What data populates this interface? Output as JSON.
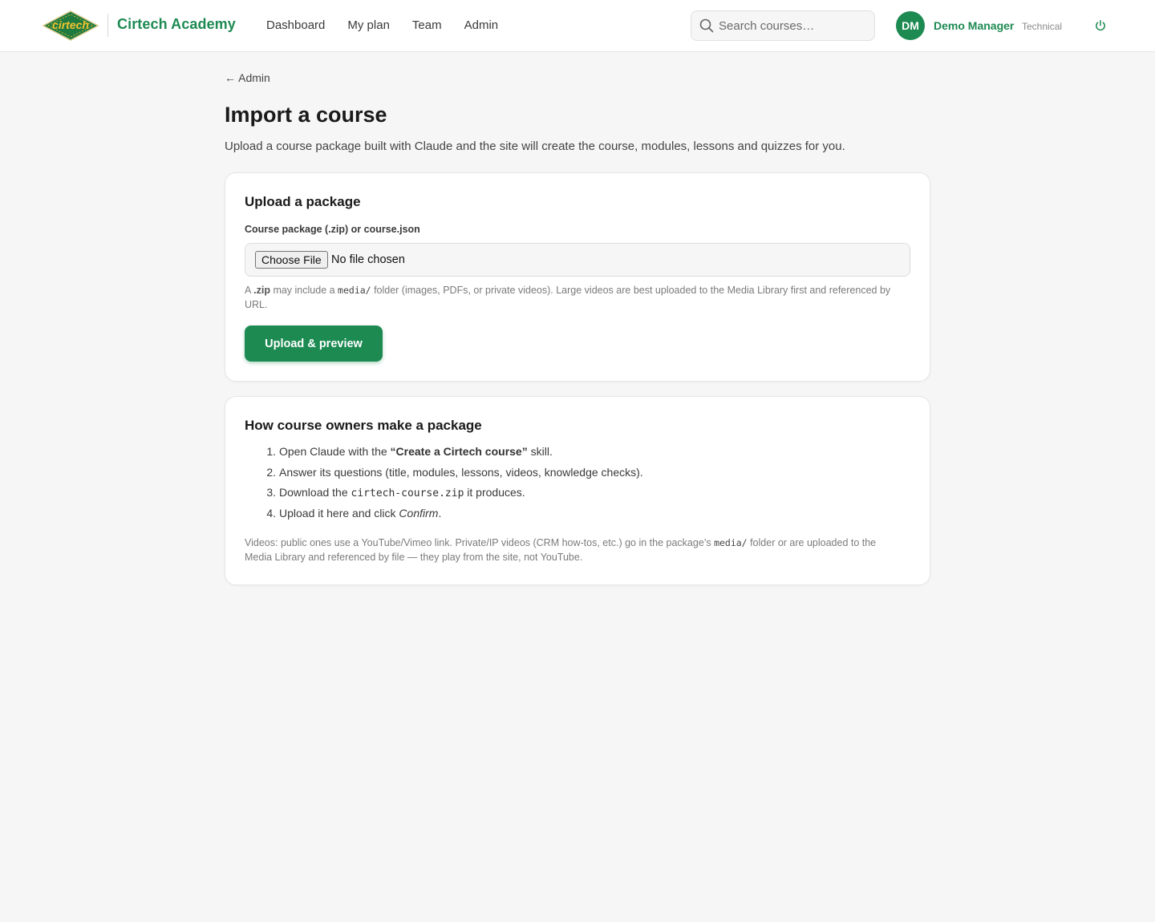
{
  "header": {
    "logo_text": "cirtech",
    "brand": "Cirtech Academy",
    "nav": [
      {
        "label": "Dashboard"
      },
      {
        "label": "My plan"
      },
      {
        "label": "Team"
      },
      {
        "label": "Admin"
      }
    ],
    "search_placeholder": "Search courses…",
    "user": {
      "initials": "DM",
      "name": "Demo Manager",
      "role": "Technical"
    },
    "colors": {
      "accent": "#1d8a52",
      "logo_fill": "#1f7a3f",
      "logo_text": "#f2c230"
    },
    "icons": {
      "search": "search-icon",
      "power": "power-icon"
    }
  },
  "page": {
    "back_label": "← Admin",
    "title": "Import a course",
    "subtitle": "Upload a course package built with Claude and the site will create the course, modules, lessons and quizzes for you."
  },
  "upload": {
    "heading": "Upload a package",
    "field_label": "Course package (.zip) or course.json",
    "file_button": "Choose File",
    "file_status": "No file chosen",
    "help": {
      "p1": "A ",
      "zip": ".zip",
      "p2": " may include a ",
      "media": "media/",
      "p3": " folder (images, PDFs, or private videos). Large videos are best uploaded to the Media Library first and referenced by URL."
    },
    "submit_label": "Upload & preview"
  },
  "how": {
    "heading": "How course owners make a package",
    "steps": [
      {
        "num": "1.",
        "a": "Open Claude with the ",
        "b": "“Create a Cirtech course”",
        "c": " skill."
      },
      {
        "num": "2.",
        "a": "Answer its questions (title, modules, lessons, videos, knowledge checks)."
      },
      {
        "num": "3.",
        "a": "Download the ",
        "code": "cirtech-course.zip",
        "c": " it produces."
      },
      {
        "num": "4.",
        "a": "Upload it here and click ",
        "em": "Confirm",
        "c": "."
      }
    ],
    "note": {
      "p1": "Videos: public ones use a YouTube/Vimeo link. Private/IP videos (CRM how-tos, etc.) go in the package’s ",
      "media": "media/",
      "p2": " folder or are uploaded to the Media Library and referenced by file — they play from the site, not YouTube."
    }
  }
}
